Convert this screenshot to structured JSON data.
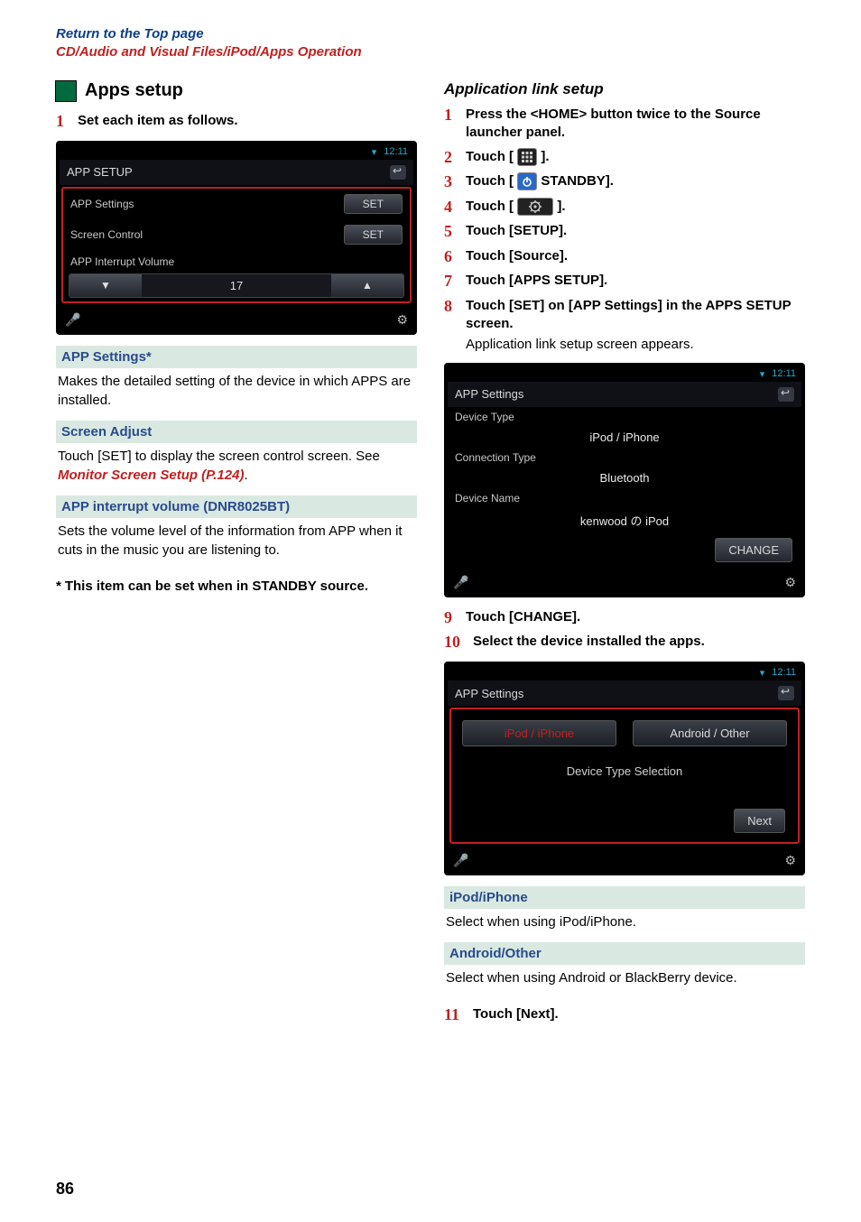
{
  "header": {
    "top_link": "Return to the Top page",
    "breadcrumb": "CD/Audio and Visual Files/iPod/Apps Operation"
  },
  "left": {
    "section_title": "Apps setup",
    "step1_num": "1",
    "step1_text": "Set each item as follows.",
    "shot1": {
      "time": "12:11",
      "title": "APP SETUP",
      "row1_label": "APP Settings",
      "row1_btn": "SET",
      "row2_label": "Screen Control",
      "row2_btn": "SET",
      "row3_label": "APP Interrupt Volume",
      "vol_value": "17",
      "down": "▼",
      "up": "▲"
    },
    "d1_head": "APP Settings*",
    "d1_body": "Makes the detailed setting of the device in which APPS are installed.",
    "d2_head": "Screen Adjust",
    "d2_body_pre": "Touch [SET] to display the screen control screen. See ",
    "d2_body_link": "Monitor Screen Setup (P.124)",
    "d2_body_post": ".",
    "d3_head": "APP interrupt volume (DNR8025BT)",
    "d3_body": "Sets the volume level of the information from APP when it cuts in the music you are listening to.",
    "footnote_star": "*",
    "footnote_text": "This item can be set when in STANDBY source."
  },
  "right": {
    "subtitle": "Application link setup",
    "s1_num": "1",
    "s1_text_a": "Press the <HOME> button twice to the Source launcher panel.",
    "s2_num": "2",
    "s2_pre": "Touch [",
    "s2_post": "].",
    "s3_num": "3",
    "s3_pre": "Touch [",
    "s3_post": " STANDBY].",
    "s4_num": "4",
    "s4_pre": "Touch [",
    "s4_post": "].",
    "s5_num": "5",
    "s5_text": "Touch [SETUP].",
    "s6_num": "6",
    "s6_text": "Touch [Source].",
    "s7_num": "7",
    "s7_text": "Touch [APPS SETUP].",
    "s8_num": "8",
    "s8_text": "Touch [SET] on [APP Settings] in the APPS SETUP screen.",
    "s8_note": "Application link setup screen appears.",
    "shot2": {
      "time": "12:11",
      "title": "APP Settings",
      "k1_label": "Device Type",
      "k1_value": "iPod / iPhone",
      "k2_label": "Connection Type",
      "k2_value": "Bluetooth",
      "k3_label": "Device Name",
      "k3_value": "kenwood の iPod",
      "change_btn": "CHANGE"
    },
    "s9_num": "9",
    "s9_text": "Touch [CHANGE].",
    "s10_num": "10",
    "s10_text": "Select the device installed the apps.",
    "shot3": {
      "time": "12:11",
      "title": "APP Settings",
      "tab1": "iPod / iPhone",
      "tab2": "Android / Other",
      "mid": "Device Type Selection",
      "next_btn": "Next"
    },
    "d4_head": "iPod/iPhone",
    "d4_body": "Select when using iPod/iPhone.",
    "d5_head": "Android/Other",
    "d5_body": "Select when using Android or BlackBerry device.",
    "s11_num": "11",
    "s11_text": "Touch [Next]."
  },
  "page_number": "86"
}
